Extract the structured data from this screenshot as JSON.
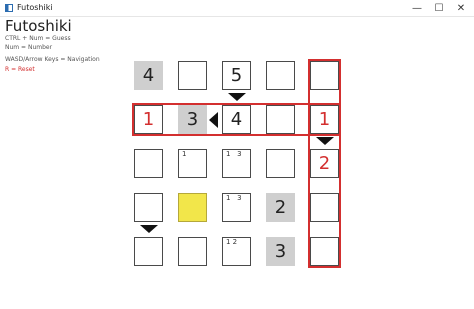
{
  "window": {
    "title": "Futoshiki",
    "icon": "app-icon",
    "controls": {
      "minimize": "—",
      "maximize": "☐",
      "close": "✕"
    }
  },
  "app": {
    "title": "Futoshiki",
    "help": [
      "CTRL + Num = Guess",
      "Num = Number",
      "WASD/Arrow Keys = Navigation"
    ],
    "reset": "R = Reset"
  },
  "board": {
    "size": 5,
    "cells": [
      [
        {
          "v": "4",
          "given": true
        },
        {
          "v": ""
        },
        {
          "v": "5"
        },
        {
          "v": ""
        },
        {
          "v": ""
        }
      ],
      [
        {
          "v": "1",
          "error": true
        },
        {
          "v": "3",
          "given": true
        },
        {
          "v": "4"
        },
        {
          "v": ""
        },
        {
          "v": "1",
          "error": true
        }
      ],
      [
        {
          "v": ""
        },
        {
          "notes": "1"
        },
        {
          "notes": "1   3"
        },
        {
          "v": ""
        },
        {
          "v": "2",
          "error": true
        }
      ],
      [
        {
          "v": ""
        },
        {
          "v": "",
          "selected": true
        },
        {
          "notes": "1   3"
        },
        {
          "v": "2",
          "given": true
        },
        {
          "v": ""
        }
      ],
      [
        {
          "v": ""
        },
        {
          "v": ""
        },
        {
          "notes": "1 2"
        },
        {
          "v": "3",
          "given": true
        },
        {
          "v": ""
        }
      ]
    ],
    "constraints": [
      {
        "type": "down",
        "row": 0,
        "col": 2
      },
      {
        "type": "left",
        "row": 1,
        "col": 1
      },
      {
        "type": "down",
        "row": 1,
        "col": 4
      },
      {
        "type": "down",
        "row": 3,
        "col": 0
      }
    ],
    "highlights": [
      {
        "kind": "row",
        "index": 1
      },
      {
        "kind": "col",
        "index": 4
      }
    ],
    "colors": {
      "error": "#d32f2f",
      "given": "#cfcfcf",
      "selected": "#f2e64a"
    }
  }
}
